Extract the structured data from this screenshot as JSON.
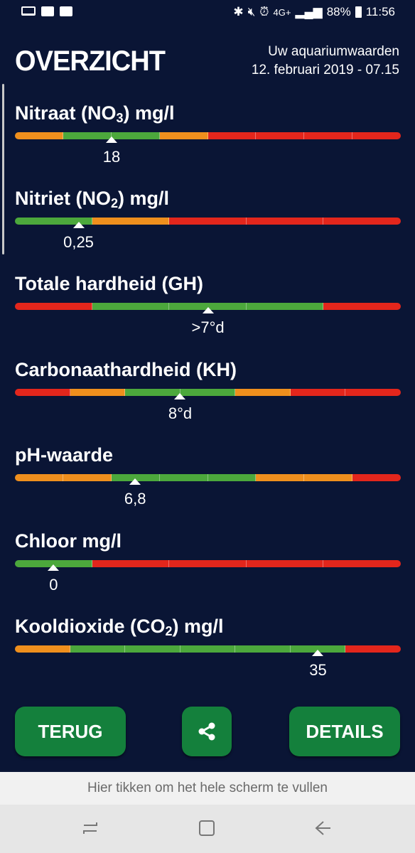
{
  "status_bar": {
    "network": "4G+",
    "battery": "88%",
    "time": "11:56"
  },
  "header": {
    "title": "OVERZICHT",
    "subtitle_line1": "Uw aquariumwaarden",
    "subtitle_line2": "12. februari 2019 - 07.15"
  },
  "colors": {
    "background": "#0a1535",
    "green": "#4ca83c",
    "orange": "#ef8f1d",
    "red": "#e3261c",
    "button": "#14803c"
  },
  "parameters": [
    {
      "label_pre": "Nitraat (NO",
      "label_sub": "3",
      "label_post": ") mg/l",
      "value": "18",
      "marker_fraction": 0.25,
      "segments": [
        "o",
        "g",
        "g",
        "o",
        "r",
        "r",
        "r",
        "r"
      ]
    },
    {
      "label_pre": "Nitriet (NO",
      "label_sub": "2",
      "label_post": ") mg/l",
      "value": "0,25",
      "marker_fraction": 0.165,
      "segments": [
        "g",
        "o",
        "r",
        "r",
        "r"
      ]
    },
    {
      "label_pre": "Totale hardheid (GH)",
      "label_sub": "",
      "label_post": "",
      "value": ">7°d",
      "marker_fraction": 0.5,
      "segments": [
        "r",
        "g",
        "g",
        "g",
        "r"
      ]
    },
    {
      "label_pre": "Carbonaathardheid (KH)",
      "label_sub": "",
      "label_post": "",
      "value": "8°d",
      "marker_fraction": 0.428,
      "segments": [
        "r",
        "o",
        "g",
        "g",
        "o",
        "r",
        "r"
      ]
    },
    {
      "label_pre": "pH-waarde",
      "label_sub": "",
      "label_post": "",
      "value": "6,8",
      "marker_fraction": 0.312,
      "segments": [
        "o",
        "o",
        "g",
        "g",
        "g",
        "o",
        "o",
        "r"
      ]
    },
    {
      "label_pre": "Chloor mg/l",
      "label_sub": "",
      "label_post": "",
      "value": "0",
      "marker_fraction": 0.1,
      "segments": [
        "g",
        "r",
        "r",
        "r",
        "r"
      ]
    },
    {
      "label_pre": "Kooldioxide (CO",
      "label_sub": "2",
      "label_post": ") mg/l",
      "value": "35",
      "marker_fraction": 0.785,
      "segments": [
        "o",
        "g",
        "g",
        "g",
        "g",
        "g",
        "r"
      ]
    }
  ],
  "buttons": {
    "back": "TERUG",
    "share_icon": "share-icon",
    "details": "DETAILS"
  },
  "footer_hint": "Hier tikken om het hele scherm te vullen"
}
